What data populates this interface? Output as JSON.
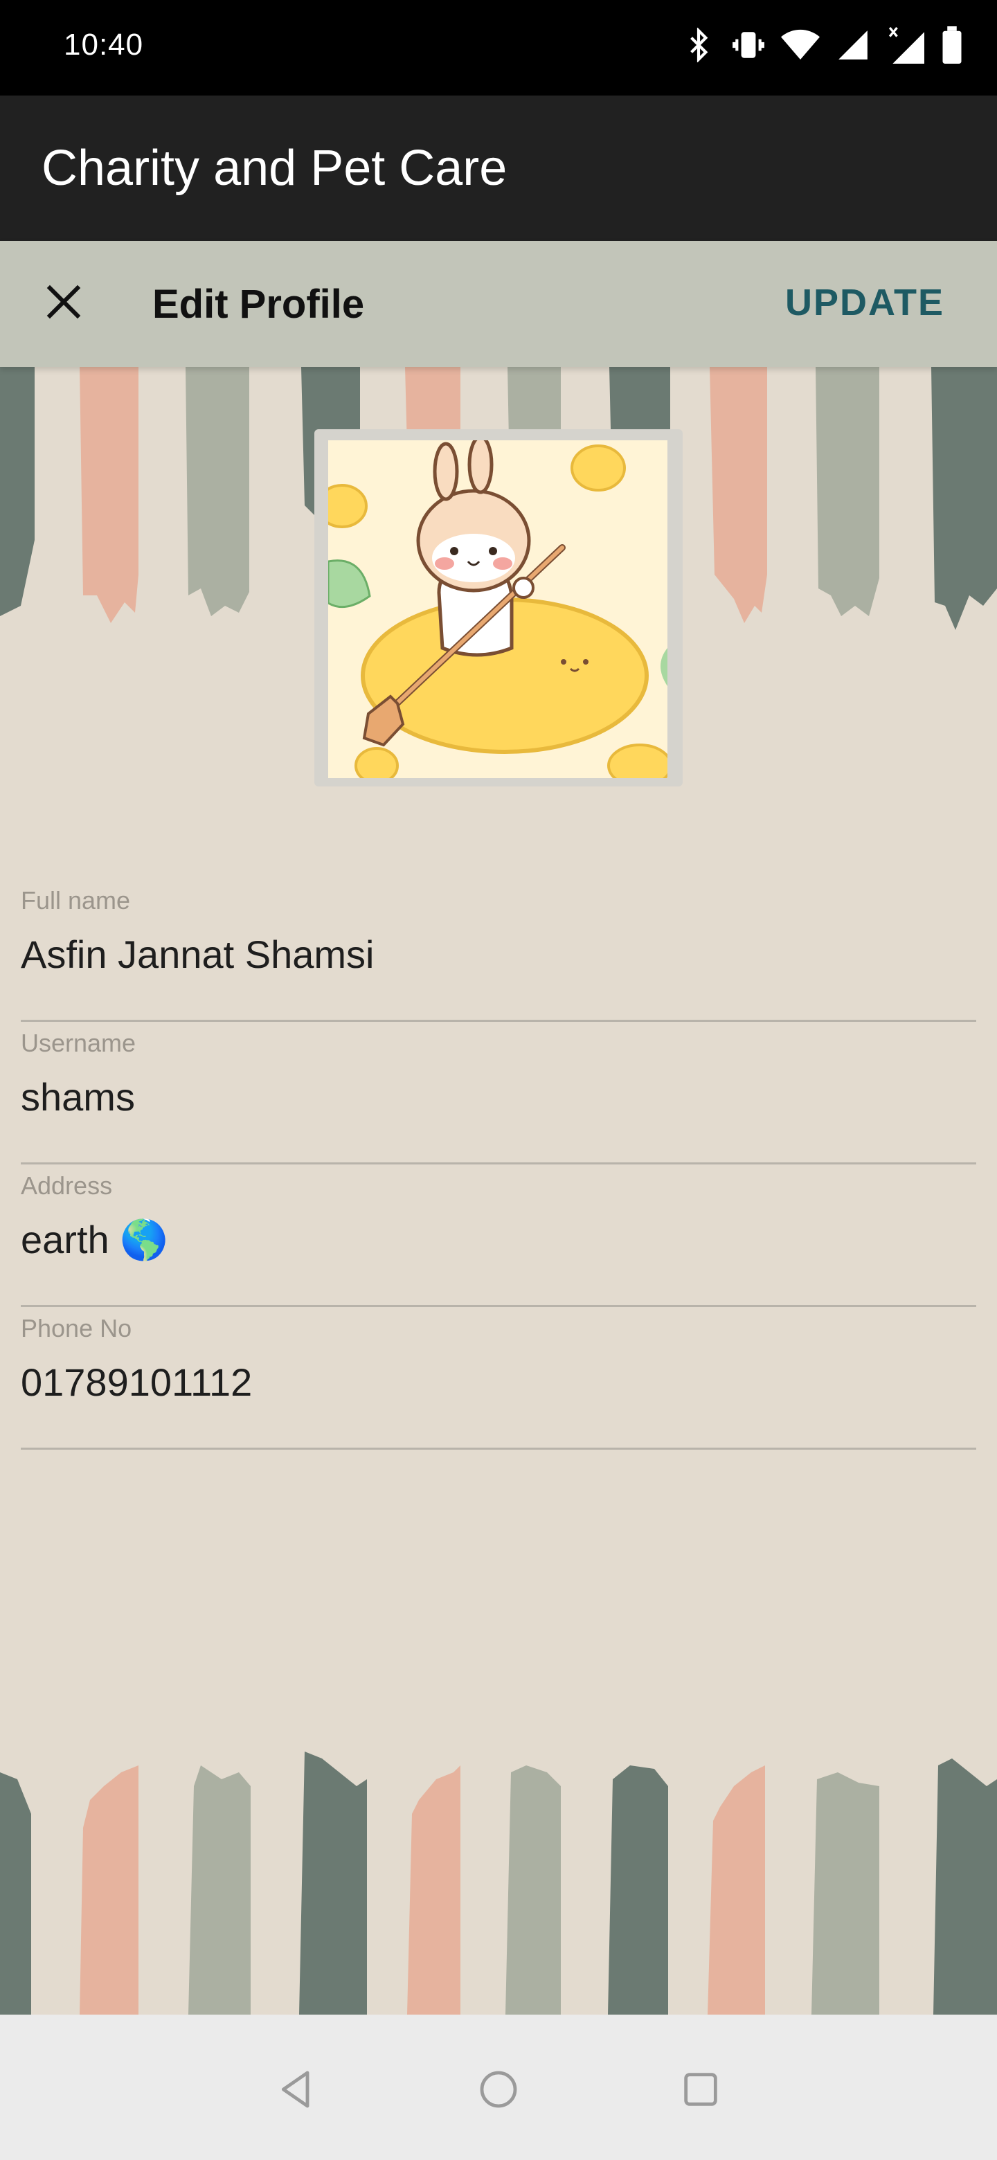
{
  "status_bar": {
    "time": "10:40",
    "icons": [
      "bluetooth-icon",
      "vibrate-icon",
      "wifi-icon",
      "signal-icon",
      "signal-x-icon",
      "battery-icon"
    ]
  },
  "app_bar": {
    "title": "Charity and Pet Care"
  },
  "toolbar": {
    "close_icon": "close-icon",
    "title": "Edit Profile",
    "update_label": "UPDATE"
  },
  "profile": {
    "avatar": "bunny-rowing-illustration"
  },
  "form": {
    "fields": [
      {
        "label": "Full name",
        "value": "Asfin Jannat Shamsi"
      },
      {
        "label": "Username",
        "value": "shams"
      },
      {
        "label": "Address",
        "value": "earth 🌎"
      },
      {
        "label": "Phone No",
        "value": "01789101112"
      }
    ]
  },
  "nav_bar": {
    "icons": [
      "back-icon",
      "home-icon",
      "recents-icon"
    ]
  },
  "colors": {
    "status_bar": "#000000",
    "app_bar": "#212121",
    "toolbar": "#c2c5b9",
    "accent": "#1e5a63",
    "background": "#e3dbcf",
    "brush_dark": "#6b7a72",
    "brush_salmon": "#e6b39e",
    "brush_sage": "#abb0a2"
  }
}
